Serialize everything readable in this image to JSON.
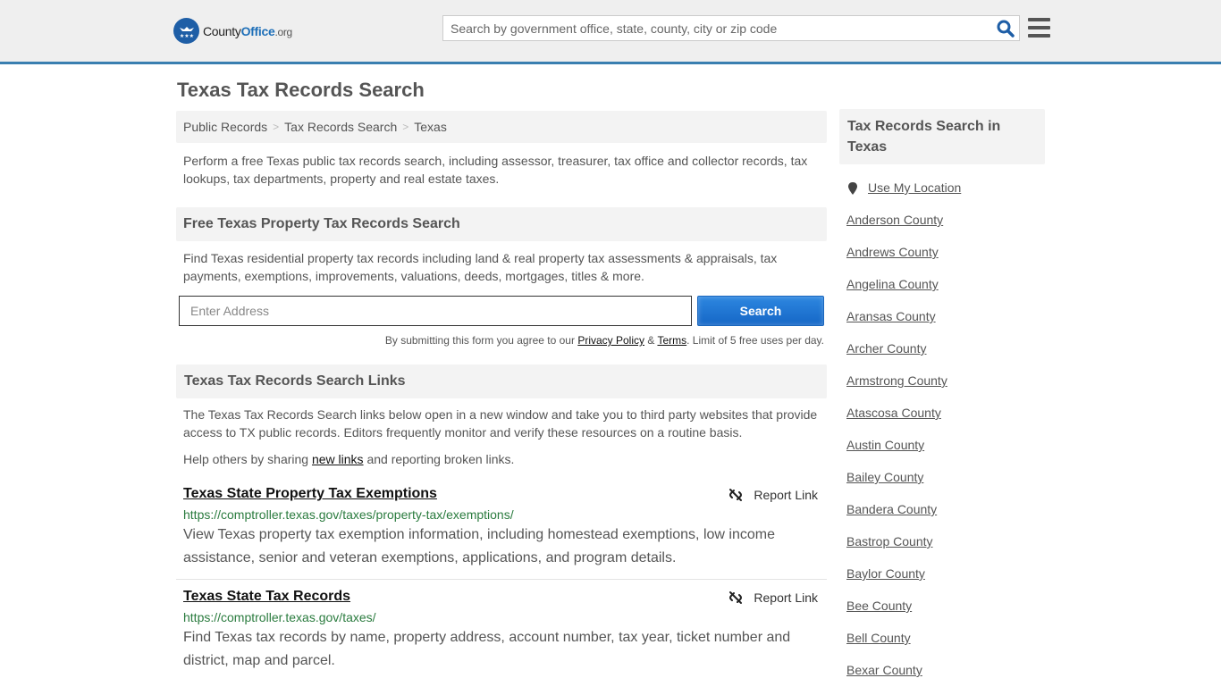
{
  "header": {
    "logo": {
      "brand_part1": "County",
      "brand_part2": "Office",
      "brand_suffix": ".org"
    },
    "search_placeholder": "Search by government office, state, county, city or zip code",
    "search_icon": "magnifier-icon",
    "menu_icon": "hamburger-menu-icon"
  },
  "page": {
    "title": "Texas Tax Records Search"
  },
  "breadcrumb": [
    {
      "label": "Public Records"
    },
    {
      "label": "Tax Records Search"
    },
    {
      "label": "Texas"
    }
  ],
  "breadcrumb_separator": ">",
  "intro": "Perform a free Texas public tax records search, including assessor, treasurer, tax office and collector records, tax lookups, tax departments, property and real estate taxes.",
  "property_search": {
    "heading": "Free Texas Property Tax Records Search",
    "description": "Find Texas residential property tax records including land & real property tax assessments & appraisals, tax payments, exemptions, improvements, valuations, deeds, mortgages, titles & more.",
    "address_placeholder": "Enter Address",
    "button_label": "Search",
    "disclaimer_prefix": "By submitting this form you agree to our ",
    "privacy_label": "Privacy Policy",
    "amp": " & ",
    "terms_label": "Terms",
    "disclaimer_suffix": ". Limit of 5 free uses per day."
  },
  "links_section": {
    "heading": "Texas Tax Records Search Links",
    "description": "The Texas Tax Records Search links below open in a new window and take you to third party websites that provide access to TX public records. Editors frequently monitor and verify these resources on a routine basis.",
    "help_prefix": "Help others by sharing ",
    "help_link": "new links",
    "help_suffix": " and reporting broken links.",
    "report_label": "Report Link",
    "items": [
      {
        "title": "Texas State Property Tax Exemptions",
        "url": "https://comptroller.texas.gov/taxes/property-tax/exemptions/",
        "description": "View Texas property tax exemption information, including homestead exemptions, low income assistance, senior and veteran exemptions, applications, and program details."
      },
      {
        "title": "Texas State Tax Records",
        "url": "https://comptroller.texas.gov/taxes/",
        "description": "Find Texas tax records by name, property address, account number, tax year, ticket number and district, map and parcel."
      }
    ]
  },
  "sidebar": {
    "heading": "Tax Records Search in Texas",
    "use_location": "Use My Location",
    "counties": [
      "Anderson County",
      "Andrews County",
      "Angelina County",
      "Aransas County",
      "Archer County",
      "Armstrong County",
      "Atascosa County",
      "Austin County",
      "Bailey County",
      "Bandera County",
      "Bastrop County",
      "Baylor County",
      "Bee County",
      "Bell County",
      "Bexar County"
    ]
  },
  "colors": {
    "accent": "#1e6fb8",
    "header_border": "#3a7fb0",
    "url_green": "#2a7b3e",
    "button_blue": "#1567c6"
  }
}
